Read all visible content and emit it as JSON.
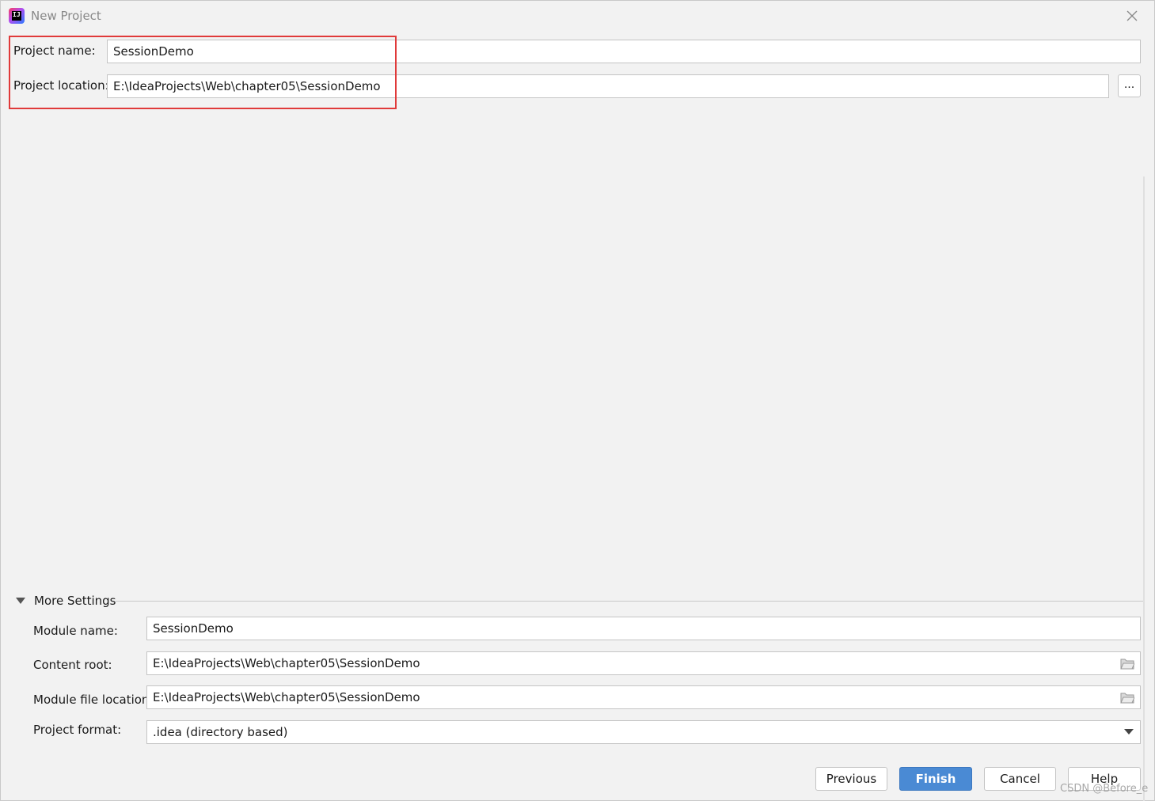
{
  "window": {
    "title": "New Project",
    "icon": "intellij-idea-icon",
    "close_icon": "close-icon"
  },
  "project": {
    "name_label": "Project name:",
    "name_value": "SessionDemo",
    "location_label": "Project location:",
    "location_value": "E:\\IdeaProjects\\Web\\chapter05\\SessionDemo",
    "browse_label": "..."
  },
  "more_settings": {
    "title": "More Settings",
    "expanded": true,
    "module_name_label": "Module name:",
    "module_name_value": "SessionDemo",
    "content_root_label": "Content root:",
    "content_root_value": "E:\\IdeaProjects\\Web\\chapter05\\SessionDemo",
    "module_file_location_label": "Module file location:",
    "module_file_location_value": "E:\\IdeaProjects\\Web\\chapter05\\SessionDemo",
    "project_format_label": "Project format:",
    "project_format_value": ".idea (directory based)"
  },
  "buttons": {
    "previous": "Previous",
    "finish": "Finish",
    "cancel": "Cancel",
    "help": "Help"
  },
  "watermark": "CSDN @Before_e",
  "colors": {
    "highlight": "#e03a3a",
    "primary_button": "#4a8ad4",
    "background": "#f2f2f2"
  }
}
